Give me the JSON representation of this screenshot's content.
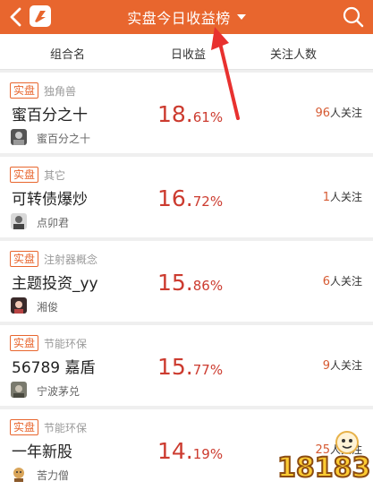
{
  "header": {
    "title": "实盘今日收益榜",
    "colors": {
      "bar": "#e8662e",
      "text": "#ffffff"
    }
  },
  "columns": [
    "组合名",
    "日收益",
    "关注人数"
  ],
  "rows": [
    {
      "tag": "实盘",
      "category": "独角兽",
      "name": "蜜百分之十",
      "owner": "蜜百分之十",
      "pct_int": "18.",
      "pct_dec": "61%",
      "followers": "96",
      "follow_label": "人关注",
      "avatar": "dark-avatar"
    },
    {
      "tag": "实盘",
      "category": "其它",
      "name": "可转债爆炒",
      "owner": "点卯君",
      "pct_int": "16.",
      "pct_dec": "72%",
      "followers": "1",
      "follow_label": "人关注",
      "avatar": "person-avatar"
    },
    {
      "tag": "实盘",
      "category": "注射器概念",
      "name": "主题投资_yy",
      "owner": "湘俊",
      "pct_int": "15.",
      "pct_dec": "86%",
      "followers": "6",
      "follow_label": "人关注",
      "avatar": "girl-avatar"
    },
    {
      "tag": "实盘",
      "category": "节能环保",
      "name": "56789 嘉盾",
      "owner": "宁波茅兑",
      "pct_int": "15.",
      "pct_dec": "77%",
      "followers": "9",
      "follow_label": "人关注",
      "avatar": "gray-avatar"
    },
    {
      "tag": "实盘",
      "category": "节能环保",
      "name": "一年新股",
      "owner": "苦力僧",
      "pct_int": "14.",
      "pct_dec": "19%",
      "followers": "25",
      "follow_label": "人关注",
      "avatar": "monk-avatar"
    }
  ],
  "watermark": {
    "text": "18183"
  },
  "colors": {
    "accent": "#e8662e",
    "percent": "#cc3b2f",
    "follower_number": "#d65a32",
    "annotation": "#e8312f"
  }
}
